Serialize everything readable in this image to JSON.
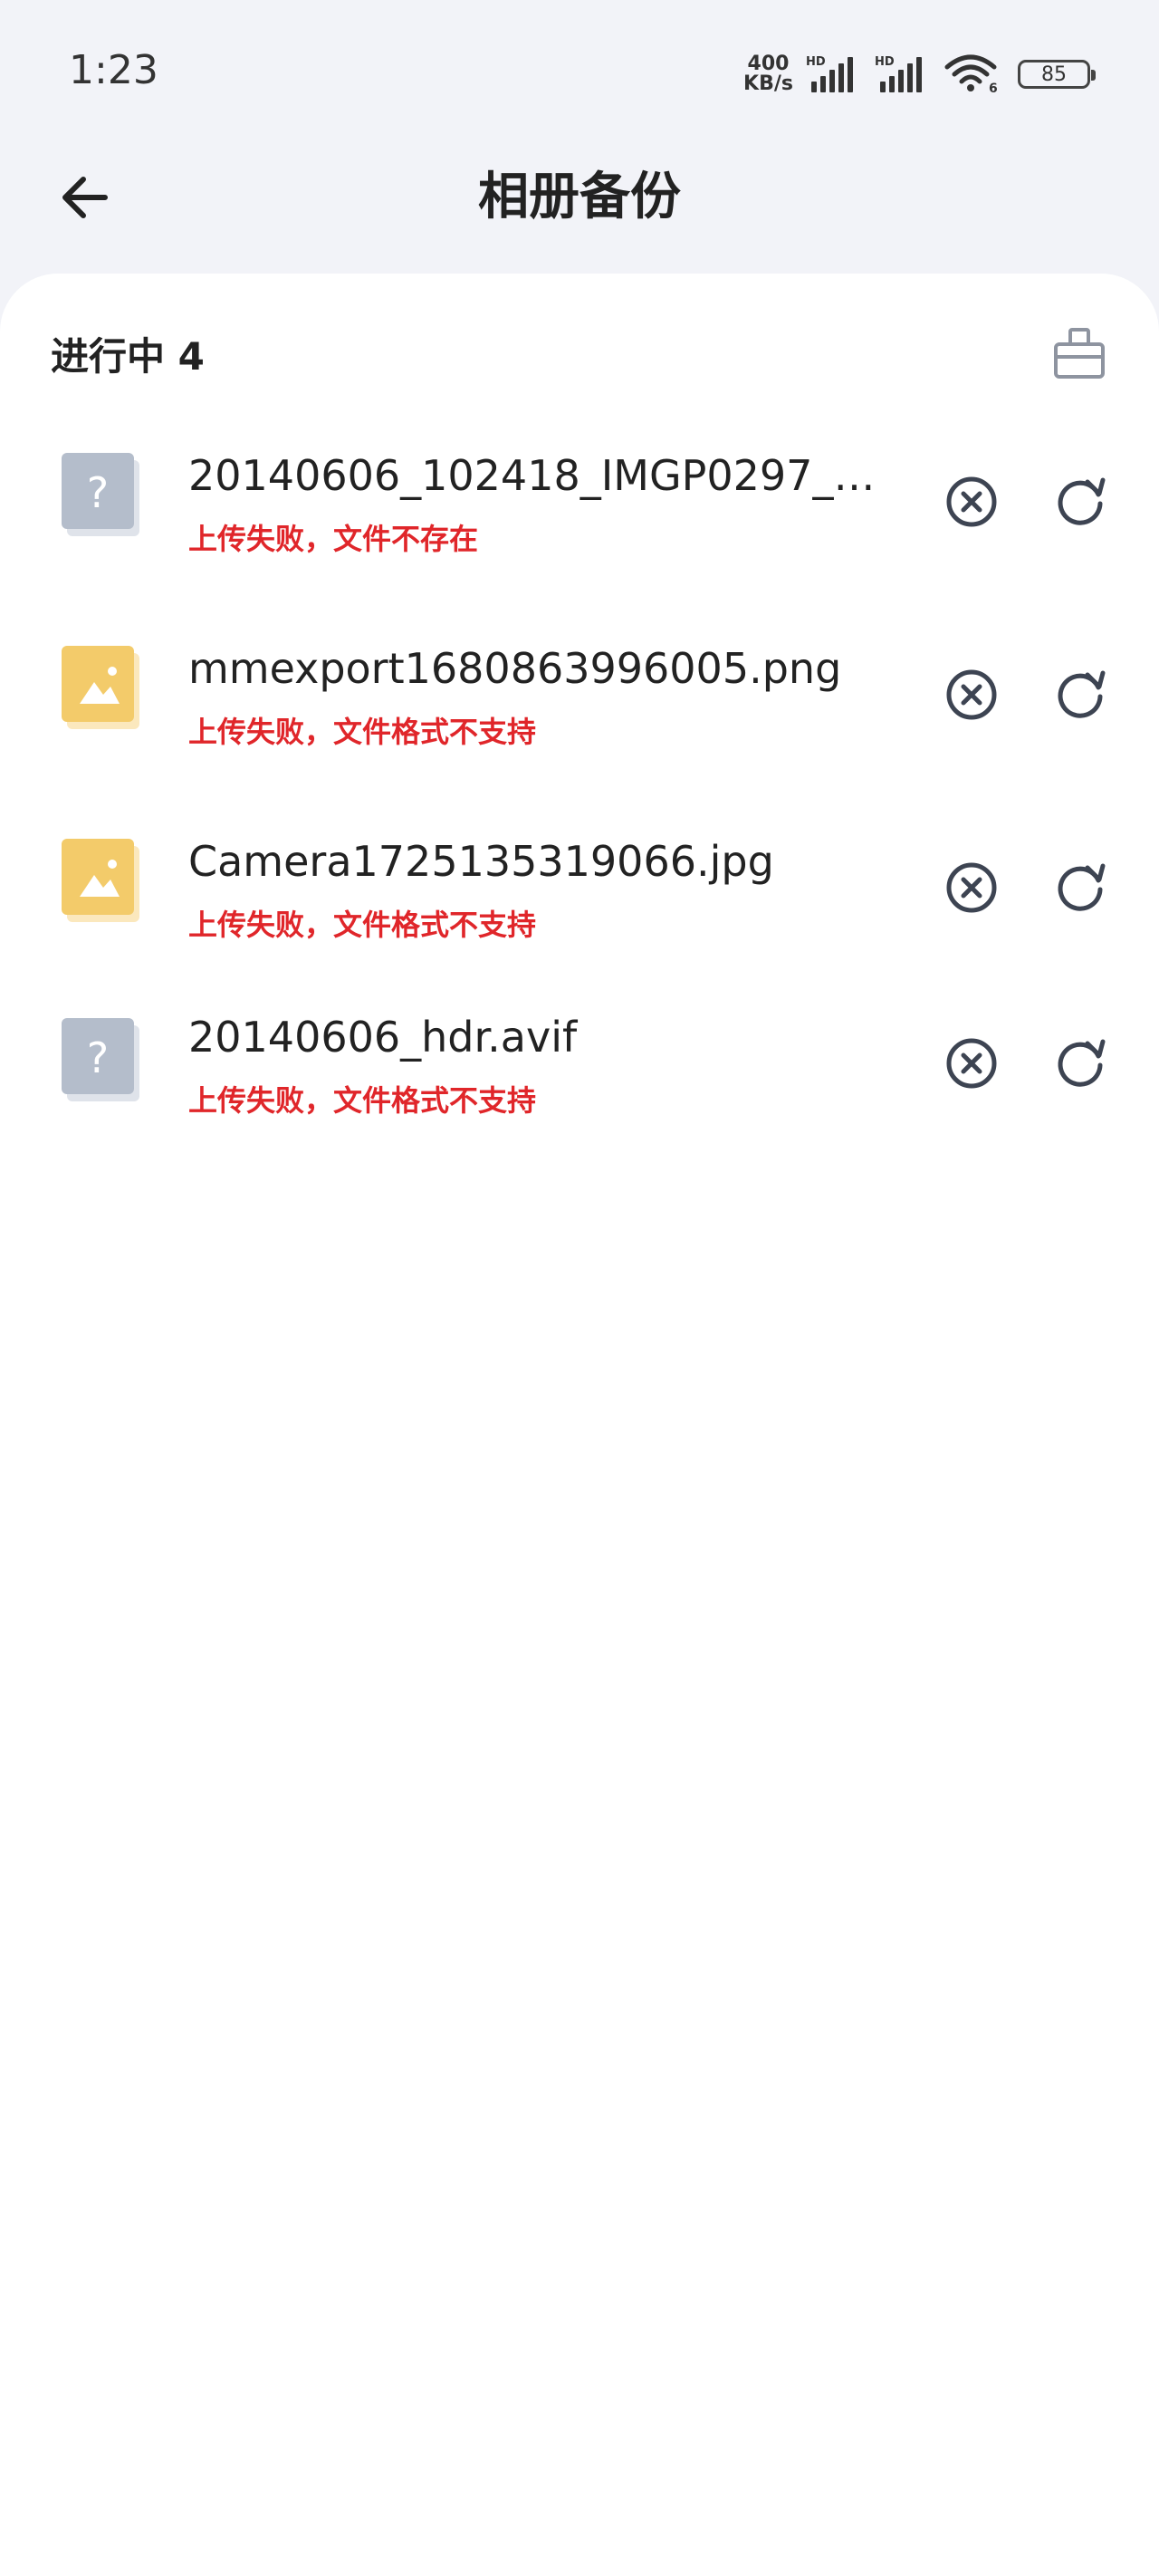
{
  "status_bar": {
    "time": "1:23",
    "net_speed_value": "400",
    "net_speed_unit": "KB/s",
    "sim1_label": "HD",
    "sim2_label": "HD",
    "wifi_sub": "6",
    "battery_level": "85"
  },
  "header": {
    "title": "相册备份"
  },
  "section": {
    "title": "进行中 4"
  },
  "colors": {
    "error": "#e0262a",
    "icon": "#3d4452",
    "unknown_thumb": "#b4bdcb",
    "image_thumb": "#f3cb6a"
  },
  "files": [
    {
      "name": "20140606_102418_IMGP0297_h...",
      "status": "上传失败，文件不存在",
      "thumb": "unknown-file-icon"
    },
    {
      "name": "mmexport1680863996005.png",
      "status": "上传失败，文件格式不支持",
      "thumb": "image-file-icon"
    },
    {
      "name": "Camera1725135319066.jpg",
      "status": "上传失败，文件格式不支持",
      "thumb": "image-file-icon"
    },
    {
      "name": "20140606_hdr.avif",
      "status": "上传失败，文件格式不支持",
      "thumb": "unknown-file-icon"
    }
  ]
}
